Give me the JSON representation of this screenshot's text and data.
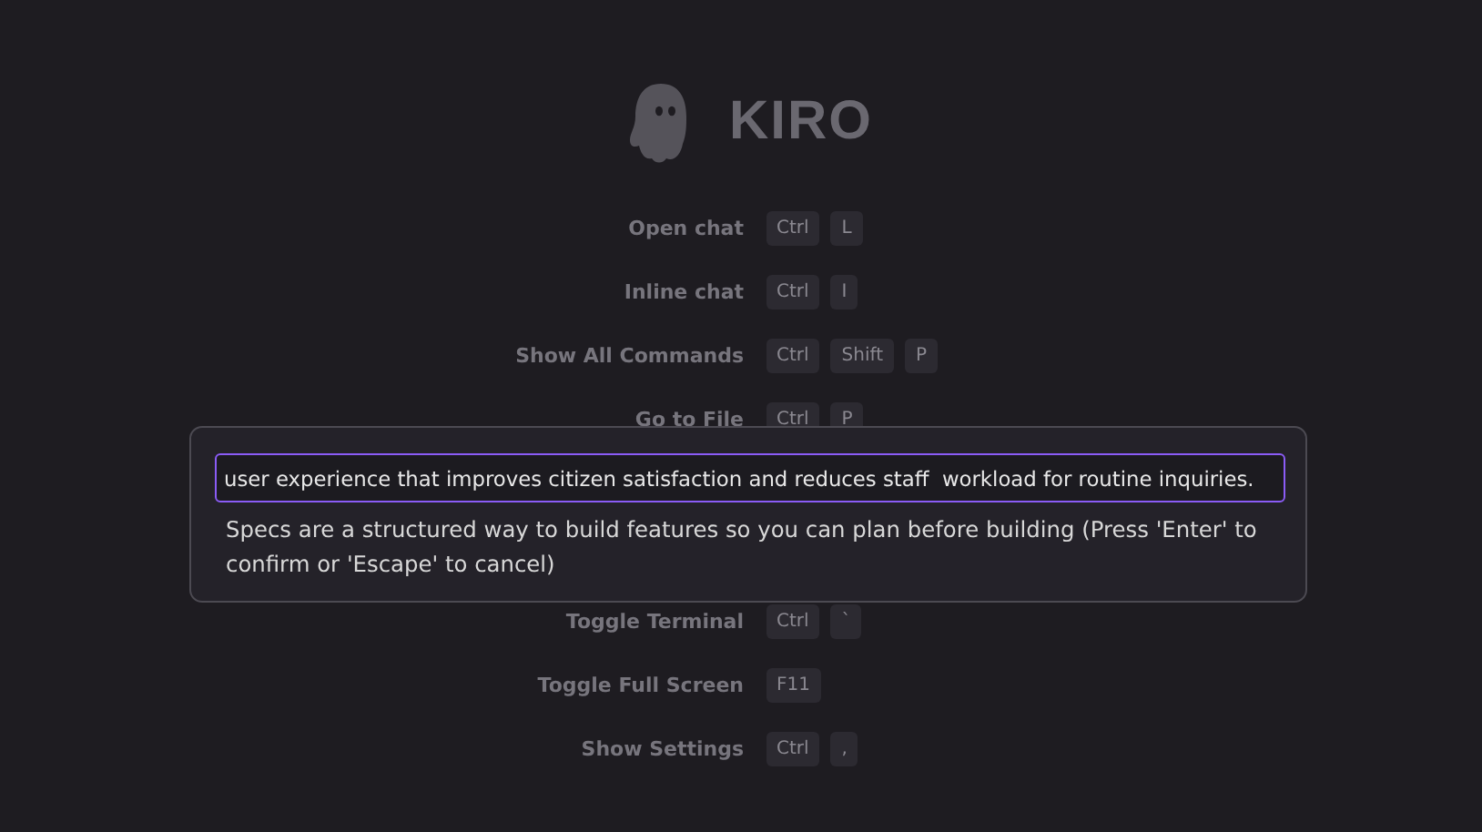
{
  "logo": {
    "wordmark": "KIRO"
  },
  "shortcuts": [
    {
      "label": "Open chat",
      "keys": [
        "Ctrl",
        "L"
      ]
    },
    {
      "label": "Inline chat",
      "keys": [
        "Ctrl",
        "I"
      ]
    },
    {
      "label": "Show All Commands",
      "keys": [
        "Ctrl",
        "Shift",
        "P"
      ]
    },
    {
      "label": "Go to File",
      "keys": [
        "Ctrl",
        "P"
      ]
    }
  ],
  "shortcuts_lower": [
    {
      "label": "Toggle Terminal",
      "keys": [
        "Ctrl",
        "`"
      ]
    },
    {
      "label": "Toggle Full Screen",
      "keys": [
        "F11"
      ]
    },
    {
      "label": "Show Settings",
      "keys": [
        "Ctrl",
        ","
      ]
    }
  ],
  "input_dialog": {
    "value": "user experience that improves citizen satisfaction and reduces staff  workload for routine inquiries.",
    "hint": "Specs are a structured way to build features so you can plan before building (Press 'Enter' to confirm or 'Escape' to cancel)"
  }
}
